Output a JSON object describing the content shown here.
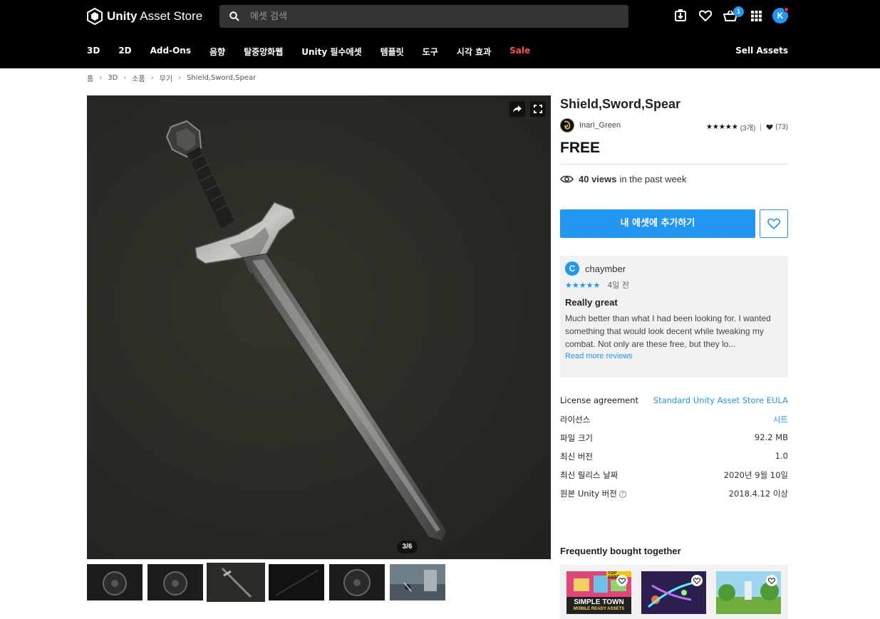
{
  "header": {
    "logo_text": "Unity Asset Store",
    "search_placeholder": "에셋 검색",
    "cart_count": "1",
    "avatar_initial": "K",
    "nav": [
      {
        "label": "3D"
      },
      {
        "label": "2D"
      },
      {
        "label": "Add-Ons"
      },
      {
        "label": "음향"
      },
      {
        "label": "탈중앙화웹"
      },
      {
        "label": "Unity 필수에셋"
      },
      {
        "label": "템플릿"
      },
      {
        "label": "도구"
      },
      {
        "label": "시각 효과"
      },
      {
        "label": "Sale"
      }
    ],
    "sell_assets": "Sell Assets",
    "icons": [
      "download-icon",
      "heart-icon",
      "cart-icon",
      "grid-icon"
    ]
  },
  "breadcrumb": [
    "홈",
    "3D",
    "소품",
    "무기",
    "Shield,Sword,Spear"
  ],
  "gallery": {
    "counter": "3/6",
    "thumbnail_count": 6,
    "active_thumbnail": 3
  },
  "product": {
    "title": "Shield,Sword,Spear",
    "publisher": "Inari_Green",
    "rating_stars": "★★★★★",
    "rating_count": "(3개)",
    "favorites": "(73)",
    "price": "FREE",
    "views_count": "40 views",
    "views_suffix": "in the past week",
    "add_button": "내 에셋에 추가하기"
  },
  "review": {
    "avatar": "C",
    "user": "chaymber",
    "stars": "★★★★★",
    "date": "4일 전",
    "title": "Really great",
    "body": "Much better than what I had been looking for. I wanted something that would look decent while tweaking my combat. Not only are these free, but they lo...",
    "more": "Read more reviews"
  },
  "details": [
    {
      "key": "License agreement",
      "value": "Standard Unity Asset Store EULA",
      "link": true
    },
    {
      "key": "라이선스",
      "value": "시트",
      "link": true
    },
    {
      "key": "파일 크기",
      "value": "92.2 MB",
      "link": false
    },
    {
      "key": "최신 버전",
      "value": "1.0",
      "link": false
    },
    {
      "key": "최신 릴리스 날짜",
      "value": "2020년 9월 10일",
      "link": false
    },
    {
      "key": "원본 Unity 버전",
      "value": "2018.4.12 이상",
      "link": false
    }
  ],
  "fbt": {
    "title": "Frequently bought together",
    "card1_text": "SIMPLE TOWN",
    "card1_sub": "MOBILE READY ASSETS",
    "card1_tag": "TOP ASSET"
  },
  "colors": {
    "accent": "#2196f3",
    "header_bg": "#000000",
    "sale": "#ff4d4d"
  }
}
